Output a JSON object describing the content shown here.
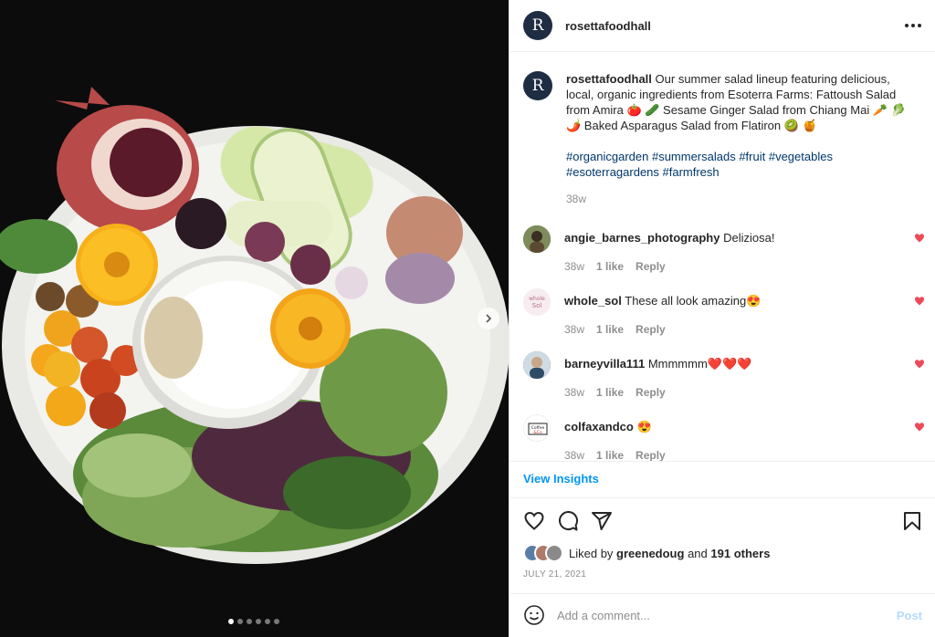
{
  "post": {
    "username": "rosettafoodhall",
    "avatar_letter": "R",
    "caption_text": "Our summer salad lineup featuring delicious, local, organic ingredients from Esoterra Farms: Fattoush Salad from Amira 🍅 🥒 Sesame Ginger Salad from Chiang Mai 🥕 🥬 🌶️ Baked Asparagus Salad from Flatiron 🥝 🍯",
    "hashtags_line1": "#organicgarden #summersalads #fruit #vegetables",
    "hashtags_line2": "#esoterragardens #farmfresh",
    "age": "38w"
  },
  "comments": [
    {
      "user": "angie_barnes_photography",
      "text": "Deliziosa!",
      "age": "38w",
      "likes": "1 like",
      "reply": "Reply",
      "avatar_color": "#6b7a4a"
    },
    {
      "user": "whole_sol",
      "text": "These all look amazing😍",
      "age": "38w",
      "likes": "1 like",
      "reply": "Reply",
      "avatar_color": "#f4e3ea"
    },
    {
      "user": "barneyvilla111",
      "text": "Mmmmmm❤️❤️❤️",
      "age": "38w",
      "likes": "1 like",
      "reply": "Reply",
      "avatar_color": "#3e5b6e"
    },
    {
      "user": "colfaxandco",
      "text": "😍",
      "age": "38w",
      "likes": "1 like",
      "reply": "Reply",
      "avatar_color": "#ffffff"
    }
  ],
  "avatar_labels": {
    "whole_sol": "whole Sol",
    "colfaxandco": "Coffee &Co"
  },
  "insights_label": "View Insights",
  "liked_by": {
    "prefix": "Liked by",
    "user": "greenedoug",
    "middle": "and",
    "others": "191 others"
  },
  "date": "JULY 21, 2021",
  "add_comment": {
    "placeholder": "Add a comment...",
    "post_label": "Post"
  },
  "carousel": {
    "count": 6,
    "active": 1
  },
  "colors": {
    "link": "#00376b",
    "accent": "#0095f6",
    "heart": "#ed4956",
    "muted": "#8e8e8e"
  }
}
